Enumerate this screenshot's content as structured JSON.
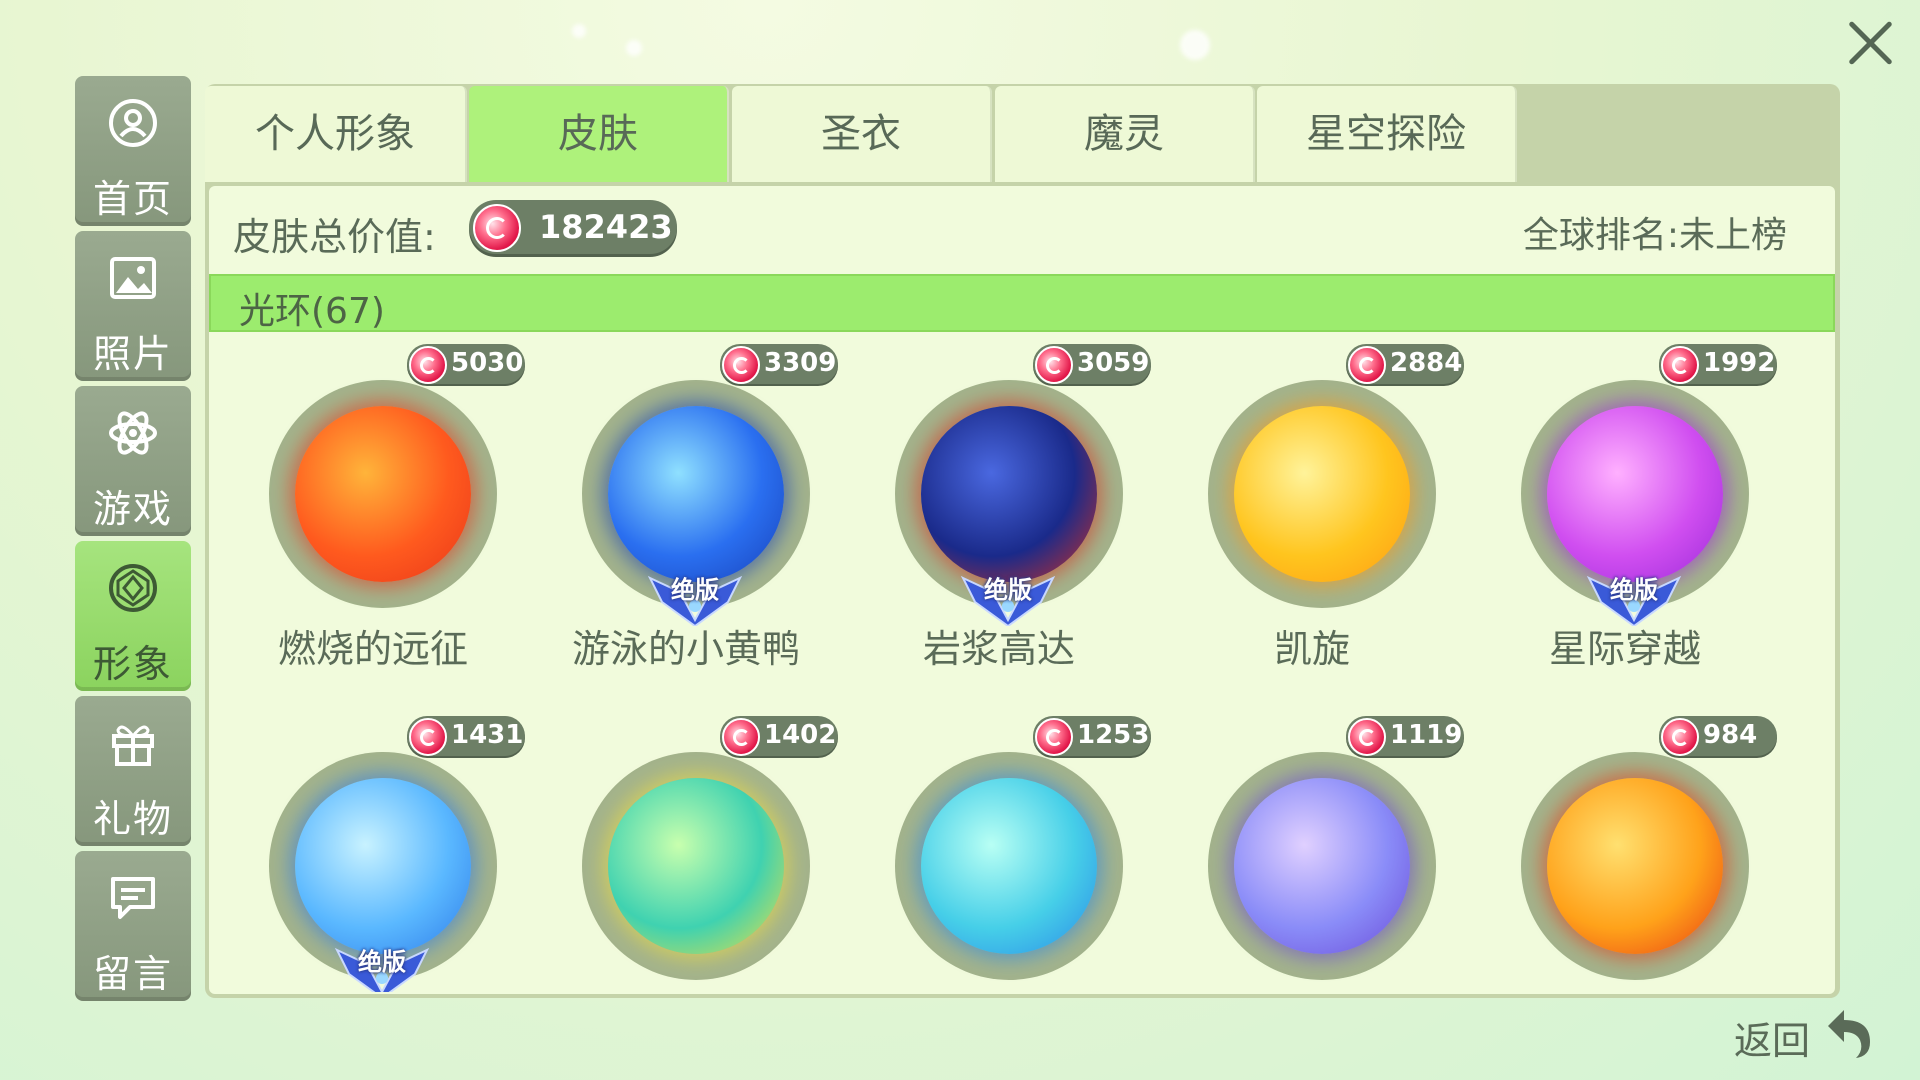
{
  "sidebar": {
    "items": [
      {
        "label": "首页",
        "icon": "user-icon",
        "active": false
      },
      {
        "label": "照片",
        "icon": "photo-icon",
        "active": false
      },
      {
        "label": "游戏",
        "icon": "atom-icon",
        "active": false
      },
      {
        "label": "形象",
        "icon": "gem-icon",
        "active": true
      },
      {
        "label": "礼物",
        "icon": "gift-icon",
        "active": false
      },
      {
        "label": "留言",
        "icon": "message-icon",
        "active": false
      }
    ]
  },
  "tabs": [
    {
      "label": "个人形象",
      "active": false
    },
    {
      "label": "皮肤",
      "active": true
    },
    {
      "label": "圣衣",
      "active": false
    },
    {
      "label": "魔灵",
      "active": false
    },
    {
      "label": "星空探险",
      "active": false
    }
  ],
  "summary": {
    "value_label": "皮肤总价值:",
    "total_value": "182423",
    "rank_text": "全球排名:未上榜"
  },
  "section": {
    "title": "光环(67)"
  },
  "items": [
    {
      "name": "燃烧的远征",
      "price": "5030",
      "badge": "",
      "colors": [
        "#ffb43a",
        "#ff5a1e",
        "#e8361a"
      ]
    },
    {
      "name": "游泳的小黄鸭",
      "price": "3309",
      "badge": "绝版",
      "colors": [
        "#8fe0ff",
        "#2a6ff0",
        "#1840b8"
      ]
    },
    {
      "name": "岩浆高达",
      "price": "3059",
      "badge": "绝版",
      "colors": [
        "#4a68e0",
        "#1a2a8a",
        "#d83020"
      ]
    },
    {
      "name": "凯旋",
      "price": "2884",
      "badge": "",
      "colors": [
        "#fff39a",
        "#ffc51e",
        "#ff9a12"
      ]
    },
    {
      "name": "星际穿越",
      "price": "1992",
      "badge": "绝版",
      "colors": [
        "#ffb0ff",
        "#d04ef0",
        "#9a2ad8"
      ]
    },
    {
      "name": "",
      "price": "1431",
      "badge": "绝版",
      "colors": [
        "#c8f2ff",
        "#5ab8ff",
        "#2d7ae8"
      ]
    },
    {
      "name": "",
      "price": "1402",
      "badge": "",
      "colors": [
        "#c8ffae",
        "#3fd2b0",
        "#f0e040"
      ]
    },
    {
      "name": "",
      "price": "1253",
      "badge": "",
      "colors": [
        "#b8fff4",
        "#46cfe8",
        "#2a88e8"
      ]
    },
    {
      "name": "",
      "price": "1119",
      "badge": "",
      "colors": [
        "#e0d0ff",
        "#8a8cf8",
        "#6a4ad8"
      ]
    },
    {
      "name": "",
      "price": "984",
      "badge": "",
      "colors": [
        "#ffe070",
        "#ffa21a",
        "#e83a12"
      ]
    }
  ],
  "back": {
    "label": "返回"
  },
  "theme": {
    "accent": "#aef27b",
    "panel": "#c5d3a9",
    "pill": "#6d7f66"
  }
}
